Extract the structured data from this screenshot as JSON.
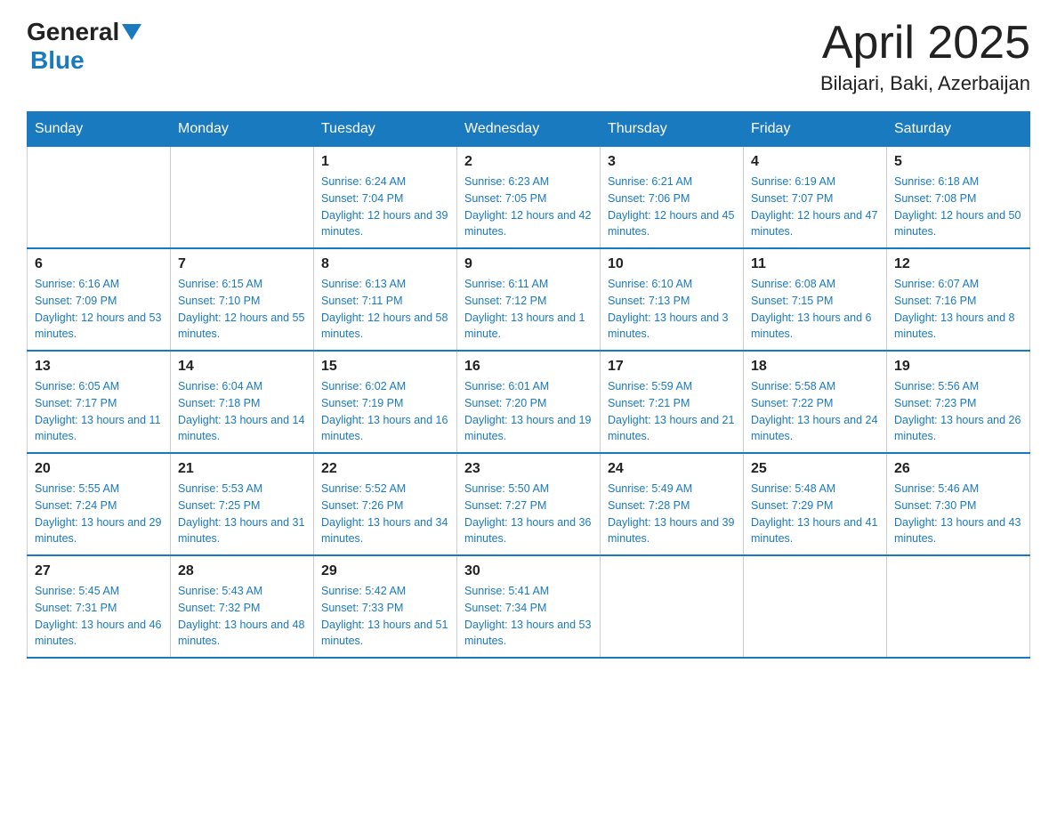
{
  "header": {
    "logo_general": "General",
    "logo_blue": "Blue",
    "month": "April 2025",
    "location": "Bilajari, Baki, Azerbaijan"
  },
  "weekdays": [
    "Sunday",
    "Monday",
    "Tuesday",
    "Wednesday",
    "Thursday",
    "Friday",
    "Saturday"
  ],
  "weeks": [
    [
      {
        "day": "",
        "sunrise": "",
        "sunset": "",
        "daylight": ""
      },
      {
        "day": "",
        "sunrise": "",
        "sunset": "",
        "daylight": ""
      },
      {
        "day": "1",
        "sunrise": "Sunrise: 6:24 AM",
        "sunset": "Sunset: 7:04 PM",
        "daylight": "Daylight: 12 hours and 39 minutes."
      },
      {
        "day": "2",
        "sunrise": "Sunrise: 6:23 AM",
        "sunset": "Sunset: 7:05 PM",
        "daylight": "Daylight: 12 hours and 42 minutes."
      },
      {
        "day": "3",
        "sunrise": "Sunrise: 6:21 AM",
        "sunset": "Sunset: 7:06 PM",
        "daylight": "Daylight: 12 hours and 45 minutes."
      },
      {
        "day": "4",
        "sunrise": "Sunrise: 6:19 AM",
        "sunset": "Sunset: 7:07 PM",
        "daylight": "Daylight: 12 hours and 47 minutes."
      },
      {
        "day": "5",
        "sunrise": "Sunrise: 6:18 AM",
        "sunset": "Sunset: 7:08 PM",
        "daylight": "Daylight: 12 hours and 50 minutes."
      }
    ],
    [
      {
        "day": "6",
        "sunrise": "Sunrise: 6:16 AM",
        "sunset": "Sunset: 7:09 PM",
        "daylight": "Daylight: 12 hours and 53 minutes."
      },
      {
        "day": "7",
        "sunrise": "Sunrise: 6:15 AM",
        "sunset": "Sunset: 7:10 PM",
        "daylight": "Daylight: 12 hours and 55 minutes."
      },
      {
        "day": "8",
        "sunrise": "Sunrise: 6:13 AM",
        "sunset": "Sunset: 7:11 PM",
        "daylight": "Daylight: 12 hours and 58 minutes."
      },
      {
        "day": "9",
        "sunrise": "Sunrise: 6:11 AM",
        "sunset": "Sunset: 7:12 PM",
        "daylight": "Daylight: 13 hours and 1 minute."
      },
      {
        "day": "10",
        "sunrise": "Sunrise: 6:10 AM",
        "sunset": "Sunset: 7:13 PM",
        "daylight": "Daylight: 13 hours and 3 minutes."
      },
      {
        "day": "11",
        "sunrise": "Sunrise: 6:08 AM",
        "sunset": "Sunset: 7:15 PM",
        "daylight": "Daylight: 13 hours and 6 minutes."
      },
      {
        "day": "12",
        "sunrise": "Sunrise: 6:07 AM",
        "sunset": "Sunset: 7:16 PM",
        "daylight": "Daylight: 13 hours and 8 minutes."
      }
    ],
    [
      {
        "day": "13",
        "sunrise": "Sunrise: 6:05 AM",
        "sunset": "Sunset: 7:17 PM",
        "daylight": "Daylight: 13 hours and 11 minutes."
      },
      {
        "day": "14",
        "sunrise": "Sunrise: 6:04 AM",
        "sunset": "Sunset: 7:18 PM",
        "daylight": "Daylight: 13 hours and 14 minutes."
      },
      {
        "day": "15",
        "sunrise": "Sunrise: 6:02 AM",
        "sunset": "Sunset: 7:19 PM",
        "daylight": "Daylight: 13 hours and 16 minutes."
      },
      {
        "day": "16",
        "sunrise": "Sunrise: 6:01 AM",
        "sunset": "Sunset: 7:20 PM",
        "daylight": "Daylight: 13 hours and 19 minutes."
      },
      {
        "day": "17",
        "sunrise": "Sunrise: 5:59 AM",
        "sunset": "Sunset: 7:21 PM",
        "daylight": "Daylight: 13 hours and 21 minutes."
      },
      {
        "day": "18",
        "sunrise": "Sunrise: 5:58 AM",
        "sunset": "Sunset: 7:22 PM",
        "daylight": "Daylight: 13 hours and 24 minutes."
      },
      {
        "day": "19",
        "sunrise": "Sunrise: 5:56 AM",
        "sunset": "Sunset: 7:23 PM",
        "daylight": "Daylight: 13 hours and 26 minutes."
      }
    ],
    [
      {
        "day": "20",
        "sunrise": "Sunrise: 5:55 AM",
        "sunset": "Sunset: 7:24 PM",
        "daylight": "Daylight: 13 hours and 29 minutes."
      },
      {
        "day": "21",
        "sunrise": "Sunrise: 5:53 AM",
        "sunset": "Sunset: 7:25 PM",
        "daylight": "Daylight: 13 hours and 31 minutes."
      },
      {
        "day": "22",
        "sunrise": "Sunrise: 5:52 AM",
        "sunset": "Sunset: 7:26 PM",
        "daylight": "Daylight: 13 hours and 34 minutes."
      },
      {
        "day": "23",
        "sunrise": "Sunrise: 5:50 AM",
        "sunset": "Sunset: 7:27 PM",
        "daylight": "Daylight: 13 hours and 36 minutes."
      },
      {
        "day": "24",
        "sunrise": "Sunrise: 5:49 AM",
        "sunset": "Sunset: 7:28 PM",
        "daylight": "Daylight: 13 hours and 39 minutes."
      },
      {
        "day": "25",
        "sunrise": "Sunrise: 5:48 AM",
        "sunset": "Sunset: 7:29 PM",
        "daylight": "Daylight: 13 hours and 41 minutes."
      },
      {
        "day": "26",
        "sunrise": "Sunrise: 5:46 AM",
        "sunset": "Sunset: 7:30 PM",
        "daylight": "Daylight: 13 hours and 43 minutes."
      }
    ],
    [
      {
        "day": "27",
        "sunrise": "Sunrise: 5:45 AM",
        "sunset": "Sunset: 7:31 PM",
        "daylight": "Daylight: 13 hours and 46 minutes."
      },
      {
        "day": "28",
        "sunrise": "Sunrise: 5:43 AM",
        "sunset": "Sunset: 7:32 PM",
        "daylight": "Daylight: 13 hours and 48 minutes."
      },
      {
        "day": "29",
        "sunrise": "Sunrise: 5:42 AM",
        "sunset": "Sunset: 7:33 PM",
        "daylight": "Daylight: 13 hours and 51 minutes."
      },
      {
        "day": "30",
        "sunrise": "Sunrise: 5:41 AM",
        "sunset": "Sunset: 7:34 PM",
        "daylight": "Daylight: 13 hours and 53 minutes."
      },
      {
        "day": "",
        "sunrise": "",
        "sunset": "",
        "daylight": ""
      },
      {
        "day": "",
        "sunrise": "",
        "sunset": "",
        "daylight": ""
      },
      {
        "day": "",
        "sunrise": "",
        "sunset": "",
        "daylight": ""
      }
    ]
  ]
}
